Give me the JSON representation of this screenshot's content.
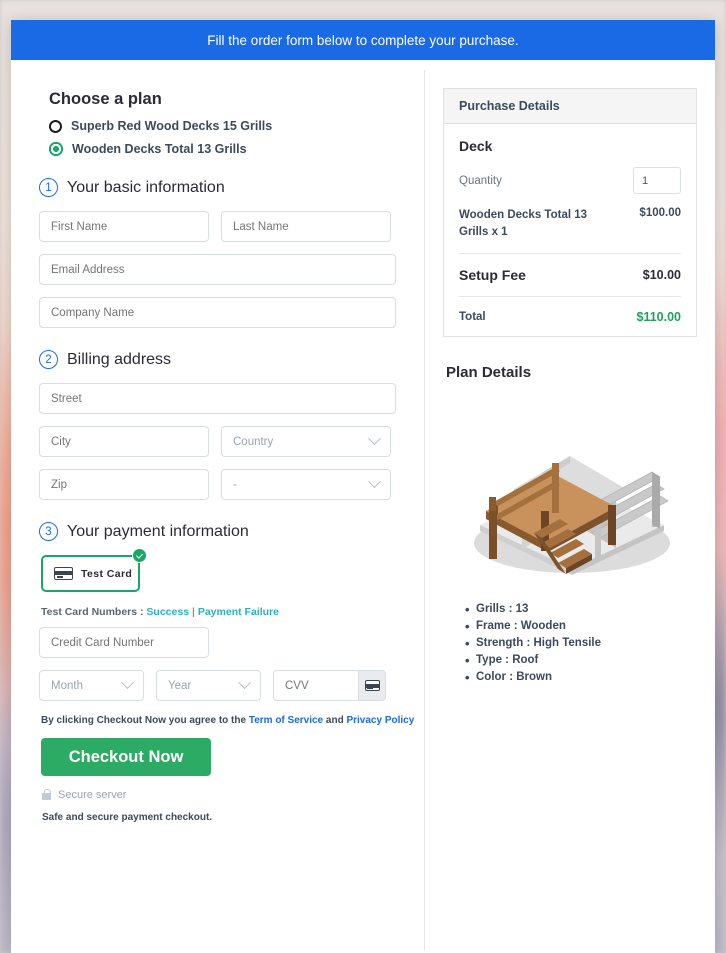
{
  "banner": {
    "text": "Fill the order form below to complete your purchase."
  },
  "plan_chooser": {
    "heading": "Choose a plan",
    "options": [
      {
        "label": "Superb Red Wood Decks 15 Grills",
        "selected": false
      },
      {
        "label": "Wooden Decks Total 13 Grills",
        "selected": true
      }
    ]
  },
  "sections": [
    {
      "number": "1",
      "title": "Your basic information"
    },
    {
      "number": "2",
      "title": "Billing address"
    },
    {
      "number": "3",
      "title": "Your payment information"
    }
  ],
  "basic_info": {
    "first_name_placeholder": "First Name",
    "last_name_placeholder": "Last Name",
    "email_placeholder": "Email Address",
    "company_placeholder": "Company Name"
  },
  "billing": {
    "street_placeholder": "Street",
    "city_placeholder": "City",
    "country_placeholder": "Country",
    "zip_placeholder": "Zip",
    "state_placeholder": "-"
  },
  "payment": {
    "card_tile_label": "Test Card",
    "test_numbers_label": "Test Card Numbers :",
    "success_link": "Success",
    "separator": "|",
    "failure_link": "Payment Failure",
    "card_number_placeholder": "Credit Card Number",
    "month_placeholder": "Month",
    "year_placeholder": "Year",
    "cvv_placeholder": "CVV"
  },
  "terms": {
    "prefix": "By clicking Checkout Now you agree to the",
    "tos_link": "Term of Service",
    "conjunction": "and",
    "privacy_link": "Privacy Policy"
  },
  "checkout": {
    "button_label": "Checkout Now",
    "secure_label": "Secure server",
    "safe_note": "Safe and secure payment checkout."
  },
  "purchase_details": {
    "heading": "Purchase Details",
    "product_title": "Deck",
    "quantity_label": "Quantity",
    "quantity_value": "1",
    "line_item_name": "Wooden Decks Total 13 Grills x 1",
    "line_item_price": "$100.00",
    "setup_fee_label": "Setup Fee",
    "setup_fee_value": "$10.00",
    "total_label": "Total",
    "total_value": "$110.00"
  },
  "plan_details": {
    "heading": "Plan Details",
    "features": [
      "Grills : 13",
      "Frame : Wooden",
      "Strength : High Tensile",
      "Type : Roof",
      "Color : Brown"
    ]
  },
  "colors": {
    "banner_blue": "#1a69e5",
    "checkout_green": "#2bab63",
    "total_green": "#21a05a",
    "link_teal": "#25b3c4",
    "link_blue": "#1a69e5"
  }
}
